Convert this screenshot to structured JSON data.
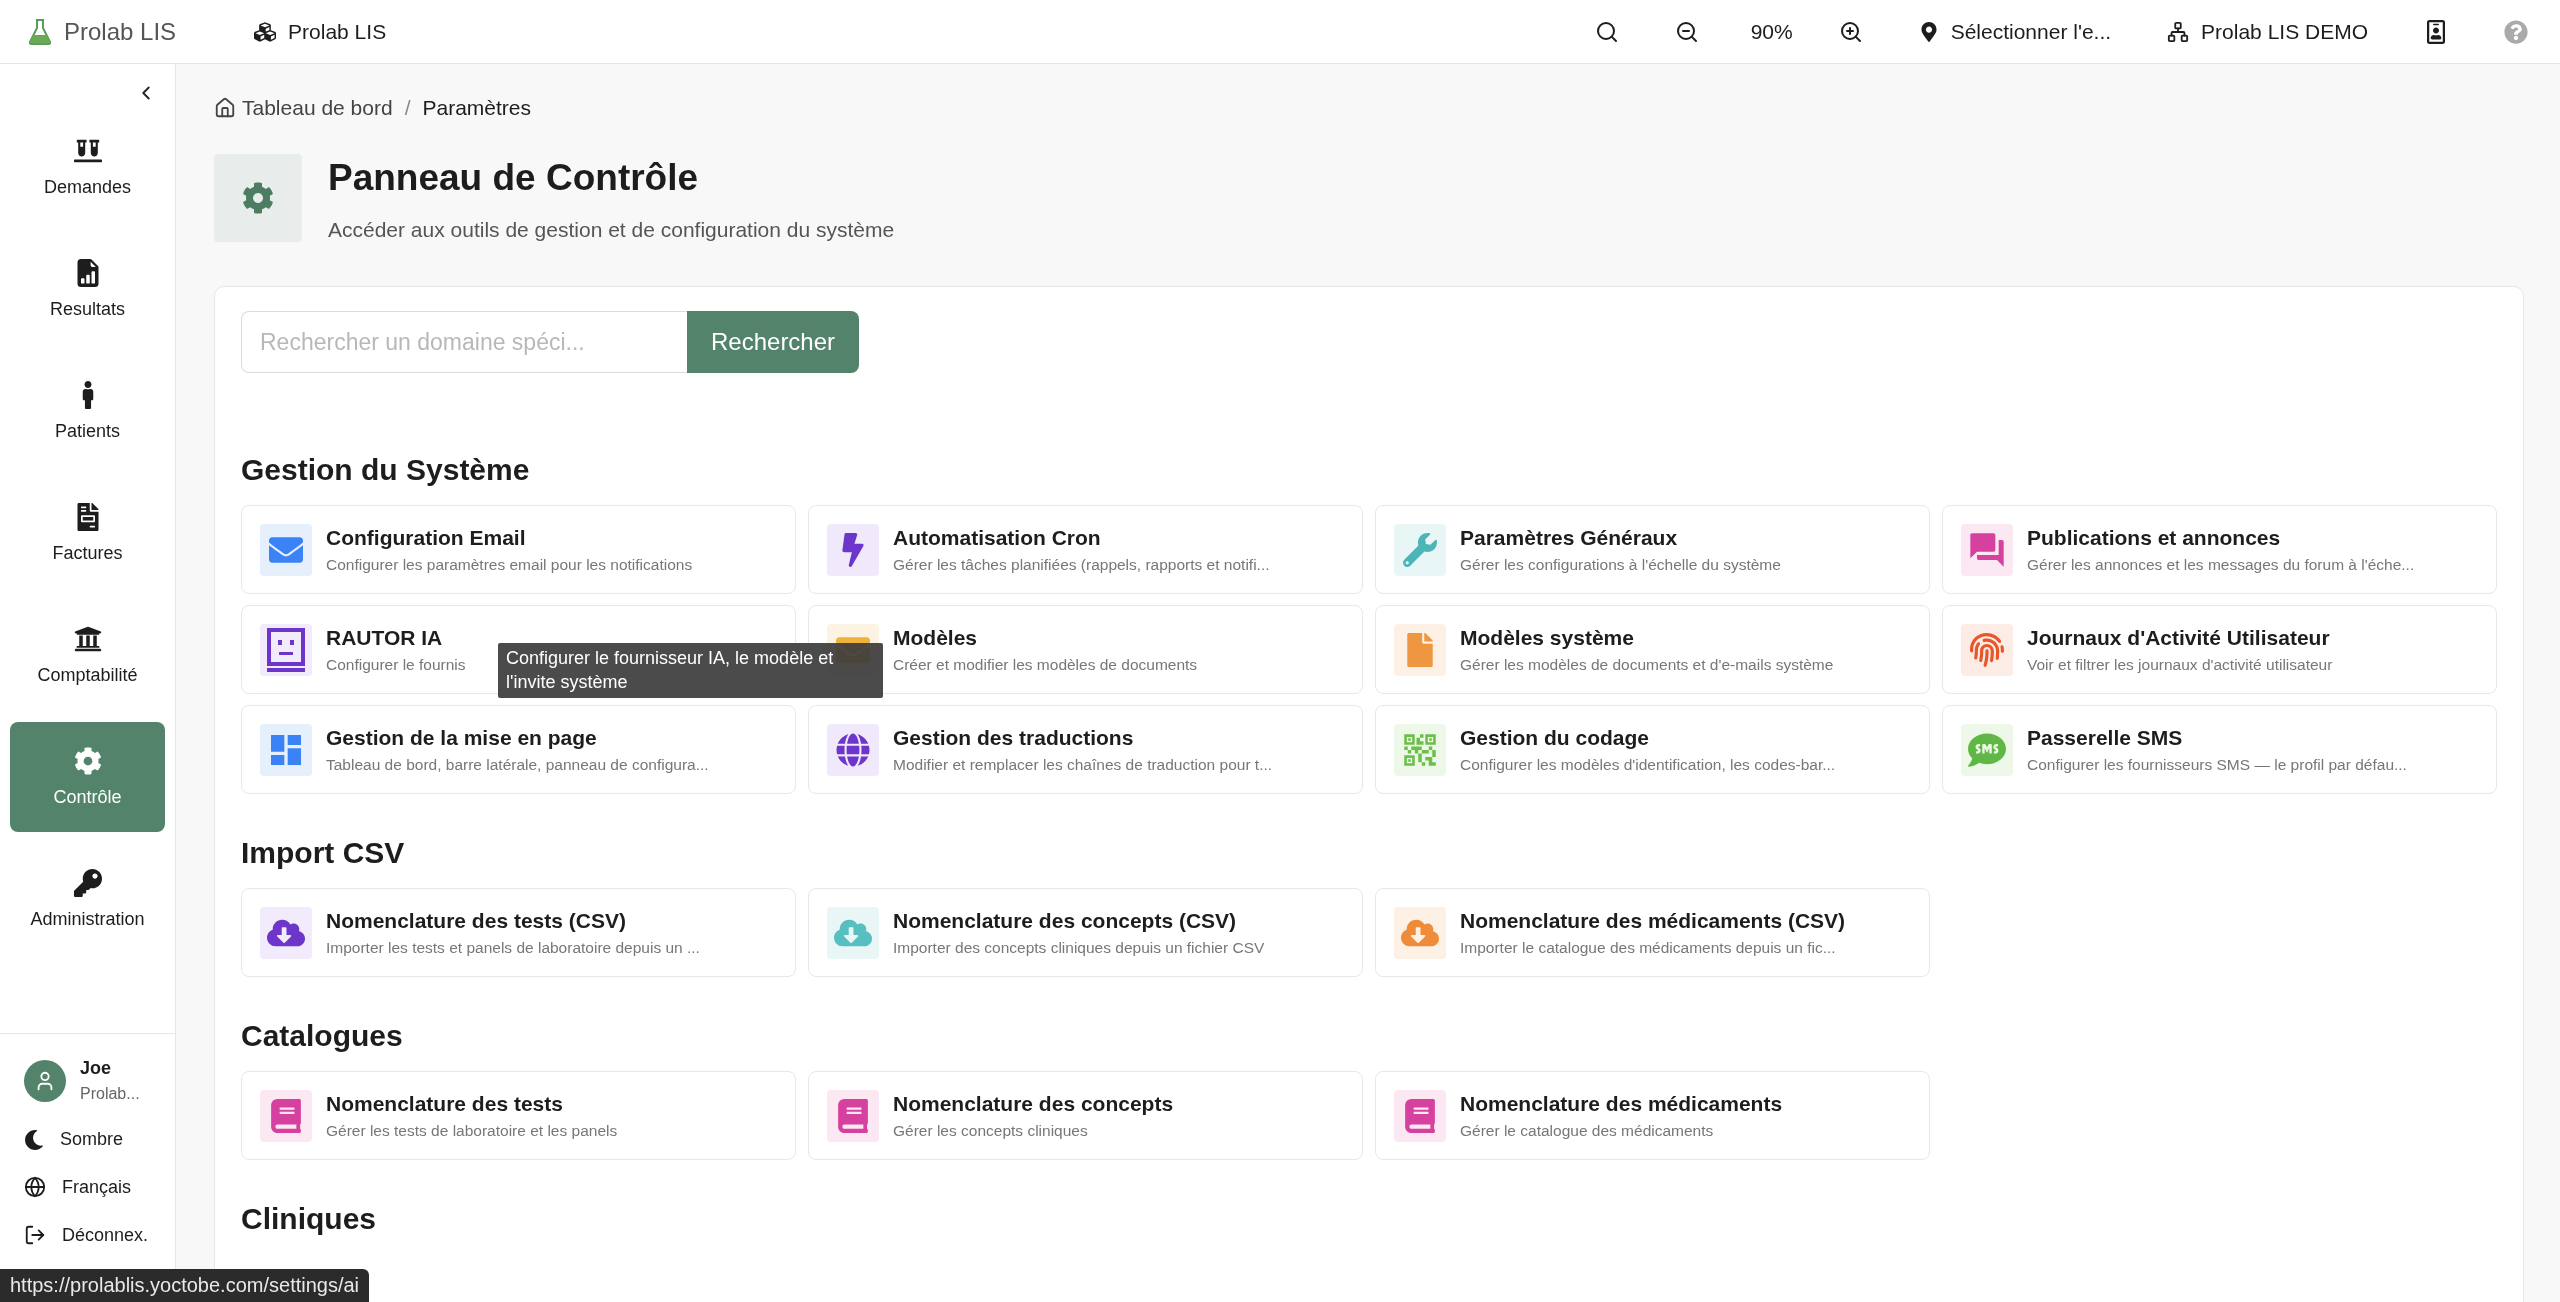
{
  "topbar": {
    "brand": "Prolab LIS",
    "org": "Prolab LIS",
    "zoom": "90%",
    "location": "Sélectionner l'e...",
    "site": "Prolab LIS DEMO"
  },
  "sidebar": {
    "items": [
      {
        "label": "Demandes",
        "selected": false
      },
      {
        "label": "Resultats",
        "selected": false
      },
      {
        "label": "Patients",
        "selected": false
      },
      {
        "label": "Factures",
        "selected": false
      },
      {
        "label": "Comptabilité",
        "selected": false
      },
      {
        "label": "Contrôle",
        "selected": true
      },
      {
        "label": "Administration",
        "selected": false
      }
    ],
    "user": {
      "name": "Joe",
      "org": "Prolab..."
    },
    "theme": "Sombre",
    "language": "Français",
    "logout": "Déconnex."
  },
  "breadcrumb": {
    "items": [
      "Tableau de bord",
      "Paramètres"
    ],
    "separator": "/"
  },
  "header": {
    "title": "Panneau de Contrôle",
    "subtitle": "Accéder aux outils de gestion et de configuration du système"
  },
  "search": {
    "placeholder": "Rechercher un domaine spéci...",
    "button": "Rechercher"
  },
  "sections": [
    {
      "title": "Gestion du Système",
      "cards": [
        {
          "title": "Configuration Email",
          "description": "Configurer les paramètres email pour les notifications"
        },
        {
          "title": "Automatisation Cron",
          "description": "Gérer les tâches planifiées (rappels, rapports et notifi..."
        },
        {
          "title": "Paramètres Généraux",
          "description": "Gérer les configurations à l'échelle du système"
        },
        {
          "title": "Publications et annonces",
          "description": "Gérer les annonces et les messages du forum à l'éche..."
        },
        {
          "title": "RAUTOR IA",
          "description": "Configurer le fournis",
          "tooltip": "Configurer le fournisseur IA, le modèle et l'invite système"
        },
        {
          "title": "Modèles",
          "description": "Créer et modifier les modèles de documents"
        },
        {
          "title": "Modèles système",
          "description": "Gérer les modèles de documents et d'e-mails système"
        },
        {
          "title": "Journaux d'Activité Utilisateur",
          "description": "Voir et filtrer les journaux d'activité utilisateur"
        },
        {
          "title": "Gestion de la mise en page",
          "description": "Tableau de bord, barre latérale, panneau de configura..."
        },
        {
          "title": "Gestion des traductions",
          "description": "Modifier et remplacer les chaînes de traduction pour t..."
        },
        {
          "title": "Gestion du codage",
          "description": "Configurer les modèles d'identification, les codes-bar..."
        },
        {
          "title": "Passerelle SMS",
          "description": "Configurer les fournisseurs SMS — le profil par défau..."
        }
      ]
    },
    {
      "title": "Import CSV",
      "cards": [
        {
          "title": "Nomenclature des tests (CSV)",
          "description": "Importer les tests et panels de laboratoire depuis un ..."
        },
        {
          "title": "Nomenclature des concepts (CSV)",
          "description": "Importer des concepts cliniques depuis un fichier CSV"
        },
        {
          "title": "Nomenclature des médicaments (CSV)",
          "description": "Importer le catalogue des médicaments depuis un fic..."
        }
      ]
    },
    {
      "title": "Catalogues",
      "cards": [
        {
          "title": "Nomenclature des tests",
          "description": "Gérer les tests de laboratoire et les panels"
        },
        {
          "title": "Nomenclature des concepts",
          "description": "Gérer les concepts cliniques"
        },
        {
          "title": "Nomenclature des médicaments",
          "description": "Gérer le catalogue des médicaments"
        }
      ]
    },
    {
      "title": "Cliniques"
    }
  ],
  "status_url": "https://prolablis.yoctobe.com/settings/ai"
}
